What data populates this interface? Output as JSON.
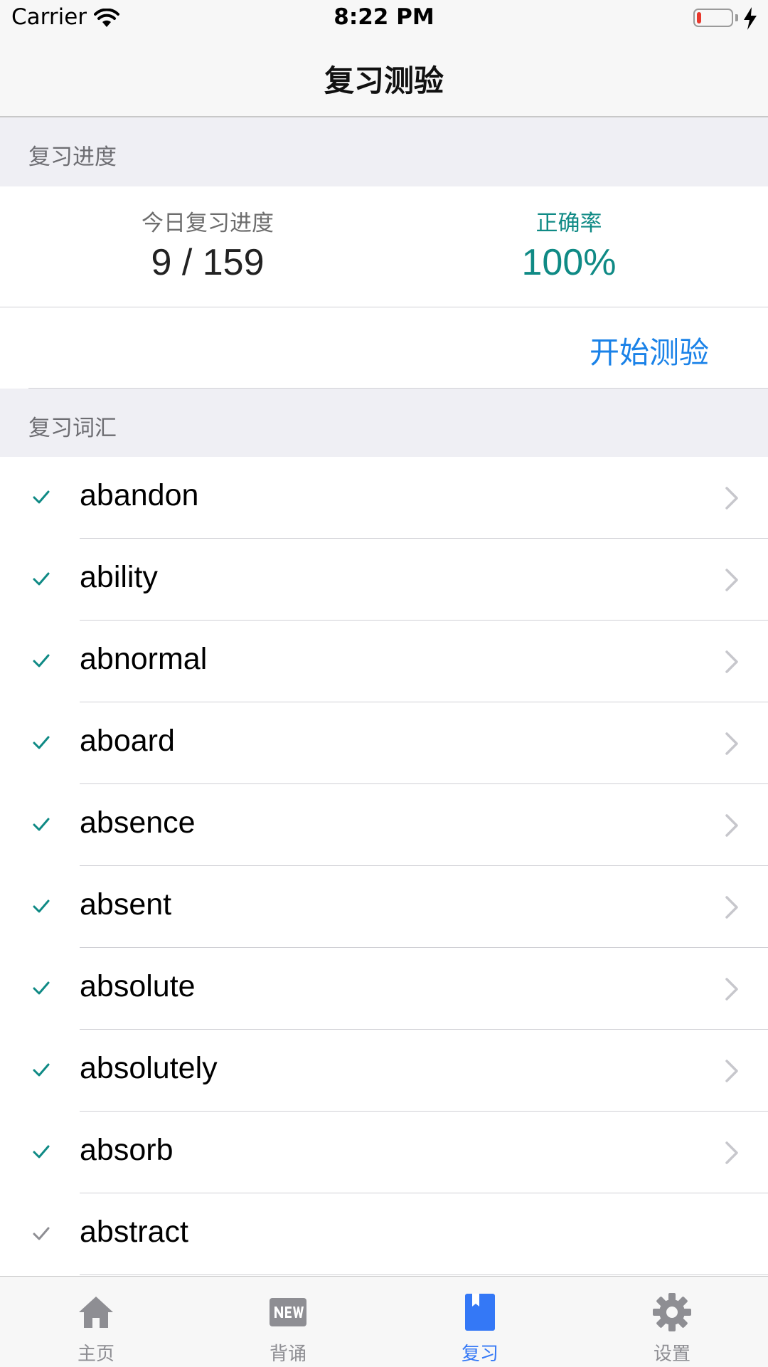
{
  "status_bar": {
    "carrier": "Carrier",
    "time": "8:22 PM",
    "battery_level": 0.12
  },
  "nav": {
    "title": "复习测验"
  },
  "progress_section": {
    "header": "复习进度",
    "today_label": "今日复习进度",
    "today_value": "9 / 159",
    "accuracy_label": "正确率",
    "accuracy_value": "100%",
    "start_button": "开始测验"
  },
  "words_section": {
    "header": "复习词汇",
    "items": [
      {
        "word": "abandon",
        "checked": true,
        "has_chevron": true
      },
      {
        "word": "ability",
        "checked": true,
        "has_chevron": true
      },
      {
        "word": "abnormal",
        "checked": true,
        "has_chevron": true
      },
      {
        "word": "aboard",
        "checked": true,
        "has_chevron": true
      },
      {
        "word": "absence",
        "checked": true,
        "has_chevron": true
      },
      {
        "word": "absent",
        "checked": true,
        "has_chevron": true
      },
      {
        "word": "absolute",
        "checked": true,
        "has_chevron": true
      },
      {
        "word": "absolutely",
        "checked": true,
        "has_chevron": true
      },
      {
        "word": "absorb",
        "checked": true,
        "has_chevron": true
      },
      {
        "word": "abstract",
        "checked": false,
        "has_chevron": false
      }
    ]
  },
  "tab_bar": {
    "tabs": [
      {
        "label": "主页",
        "icon": "home-icon"
      },
      {
        "label": "背诵",
        "icon": "new-badge-icon"
      },
      {
        "label": "复习",
        "icon": "bookmark-book-icon"
      },
      {
        "label": "设置",
        "icon": "gear-icon"
      }
    ],
    "active_index": 2
  },
  "colors": {
    "accent": "#0f8a85",
    "link": "#1a82e8",
    "tab_active": "#3478f6",
    "tab_inactive": "#8e8e93"
  }
}
